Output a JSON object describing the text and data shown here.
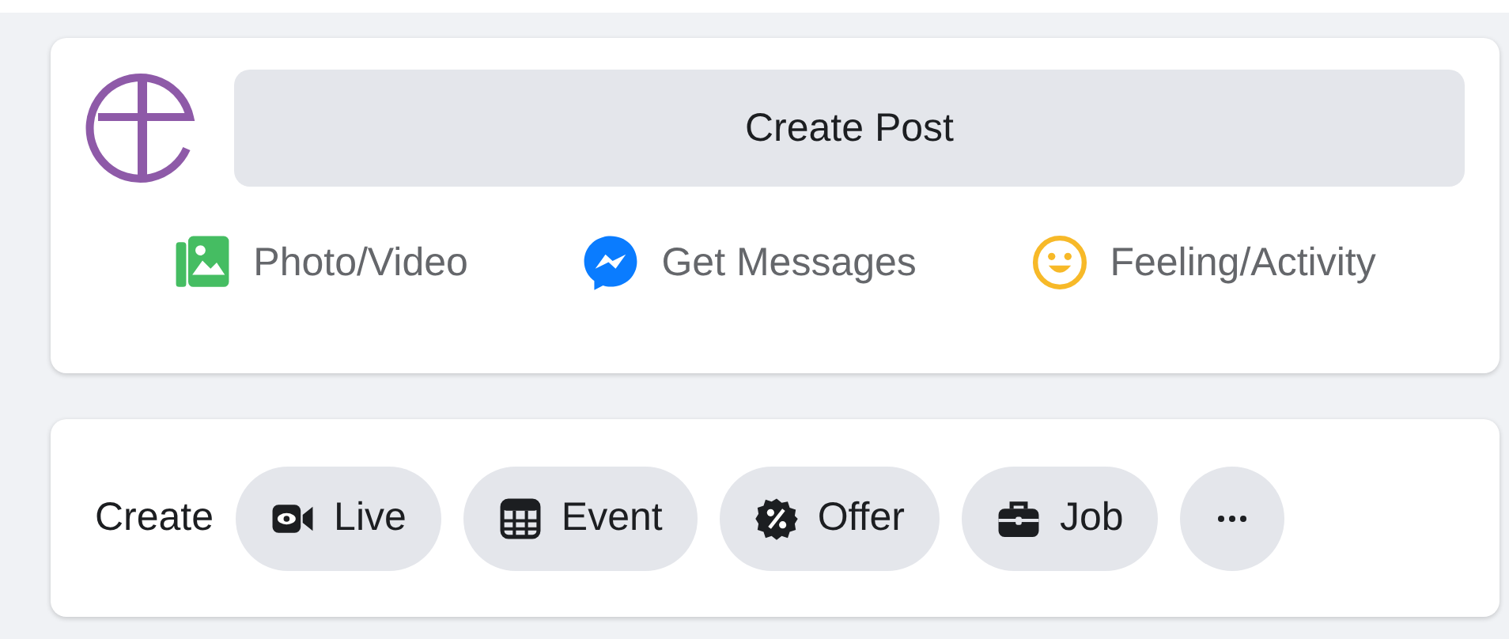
{
  "composer": {
    "create_post_label": "Create Post",
    "actions": [
      {
        "kind": "photo",
        "label": "Photo/Video"
      },
      {
        "kind": "messages",
        "label": "Get Messages"
      },
      {
        "kind": "feeling",
        "label": "Feeling/Activity"
      }
    ]
  },
  "create_bar": {
    "label": "Create",
    "buttons": [
      {
        "kind": "live",
        "label": "Live"
      },
      {
        "kind": "event",
        "label": "Event"
      },
      {
        "kind": "offer",
        "label": "Offer"
      },
      {
        "kind": "job",
        "label": "Job"
      },
      {
        "kind": "more"
      }
    ]
  }
}
